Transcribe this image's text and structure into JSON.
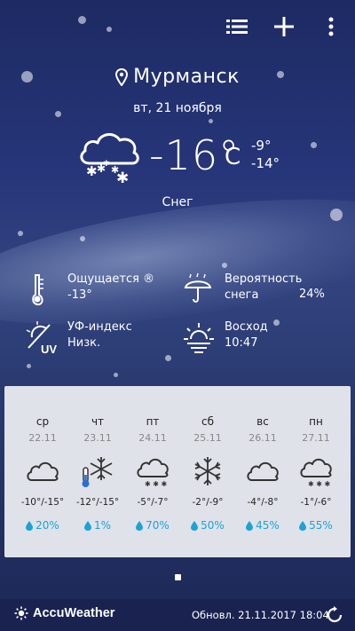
{
  "location": {
    "city": "Мурманск",
    "date": "вт, 21 ноября"
  },
  "current": {
    "temp": "-16°",
    "unit": "C",
    "high": "-9°",
    "low": "-14°",
    "condition": "Снег",
    "icon": "snow-cloud-icon"
  },
  "details": {
    "feels": {
      "label": "Ощущается ®",
      "value": "-13°",
      "icon": "thermometer-icon"
    },
    "precip": {
      "label": "Вероятность",
      "label2": "снега",
      "value": "24%",
      "icon": "umbrella-snow-icon"
    },
    "uv": {
      "label": "УФ-индекс",
      "value": "Низк.",
      "icon": "uv-icon"
    },
    "sunrise": {
      "label": "Восход",
      "value": "10:47",
      "icon": "sunrise-icon"
    }
  },
  "forecast": [
    {
      "day": "ср",
      "date": "22.11",
      "temp": "-10°/-15°",
      "precip": "20%",
      "icon": "cloud-icon"
    },
    {
      "day": "чт",
      "date": "23.11",
      "temp": "-12°/-15°",
      "precip": "1%",
      "icon": "snowflake-cold-icon"
    },
    {
      "day": "пт",
      "date": "24.11",
      "temp": "-5°/-7°",
      "precip": "70%",
      "icon": "snow-cloud-icon"
    },
    {
      "day": "сб",
      "date": "25.11",
      "temp": "-2°/-9°",
      "precip": "50%",
      "icon": "snowflake-icon"
    },
    {
      "day": "вс",
      "date": "26.11",
      "temp": "-4°/-8°",
      "precip": "45%",
      "icon": "cloud-icon"
    },
    {
      "day": "пн",
      "date": "27.11",
      "temp": "-1°/-6°",
      "precip": "55%",
      "icon": "snow-cloud-icon"
    }
  ],
  "footer": {
    "brand": "AccuWeather",
    "updated": "Обновл. 21.11.2017 18:04"
  },
  "colors": {
    "accent": "#1aa3d6",
    "panel": "#e0e2e9",
    "footer": "#1a2350"
  }
}
